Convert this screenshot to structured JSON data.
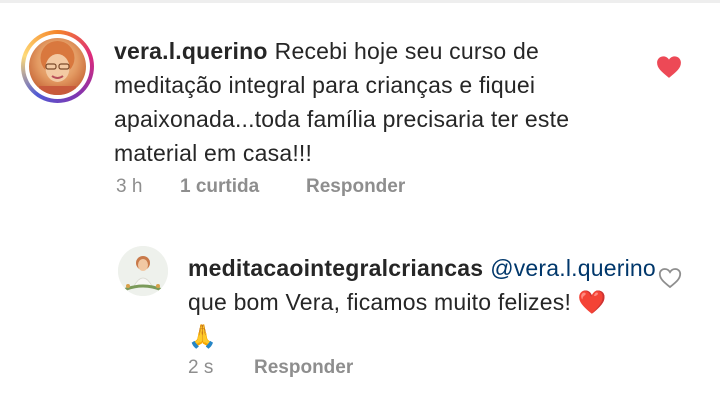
{
  "comment": {
    "username": "vera.l.querino",
    "text": "Recebi hoje seu curso de meditação integral para crianças e fiquei apaixonada...toda família precisaria ter este material em casa!!!",
    "time": "3 h",
    "likes": "1 curtida",
    "reply_label": "Responder",
    "liked": true,
    "heart_color": "#ed4956"
  },
  "reply": {
    "username": "meditacaointegralcriancas",
    "mention": "@vera.l.querino",
    "text": "que bom Vera, ficamos muito felizes!",
    "emojis": "❤️🙏",
    "time": "2 s",
    "reply_label": "Responder",
    "liked": false
  },
  "icons": {
    "comment_like": "heart-filled-icon",
    "reply_like": "heart-outline-icon"
  },
  "colors": {
    "text": "#262626",
    "meta": "#8e8e8e",
    "mention": "#00376b"
  }
}
